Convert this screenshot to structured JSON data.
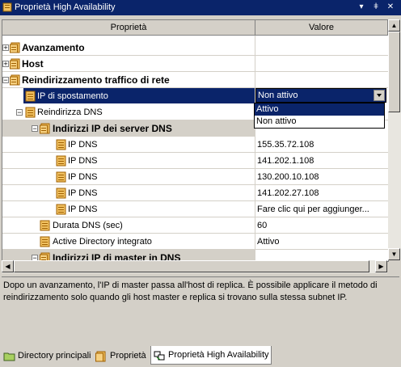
{
  "window": {
    "title": "Proprietà High Availability",
    "pin": "▾ ‡ ×"
  },
  "grid": {
    "col_property": "Proprietà",
    "col_value": "Valore",
    "rows": [
      {
        "label": "Avanzamento",
        "value": ""
      },
      {
        "label": "Host",
        "value": ""
      },
      {
        "label": "Reindirizzamento traffico di rete",
        "value": ""
      },
      {
        "label": "IP di spostamento",
        "value": "Non attivo"
      },
      {
        "label": "Reindirizza DNS",
        "value": ""
      },
      {
        "label": "Indirizzi IP dei server DNS",
        "value": ""
      },
      {
        "label": "IP DNS",
        "value": "155.35.72.108"
      },
      {
        "label": "IP DNS",
        "value": "141.202.1.108"
      },
      {
        "label": "IP DNS",
        "value": "130.200.10.108"
      },
      {
        "label": "IP DNS",
        "value": "141.202.27.108"
      },
      {
        "label": "IP DNS",
        "value": "Fare clic qui per aggiunger..."
      },
      {
        "label": "Durata DNS (sec)",
        "value": "60"
      },
      {
        "label": "Active Directory integrato",
        "value": "Attivo"
      },
      {
        "label": "Indirizzi IP di master in DNS",
        "value": ""
      }
    ],
    "dropdown_options": [
      "Attivo",
      "Non attivo"
    ]
  },
  "description": "Dopo un avanzamento, l'IP di master passa all'host di replica. È possibile applicare il metodo di reindirizzamento solo quando gli host master e replica si trovano sulla stessa subnet IP.",
  "tabs": [
    "Directory principali",
    "Proprietà",
    "Proprietà High Availability"
  ],
  "colors": {
    "titlebar": "#0a246a",
    "selection": "#0a246a",
    "chrome": "#d4d0c8"
  }
}
